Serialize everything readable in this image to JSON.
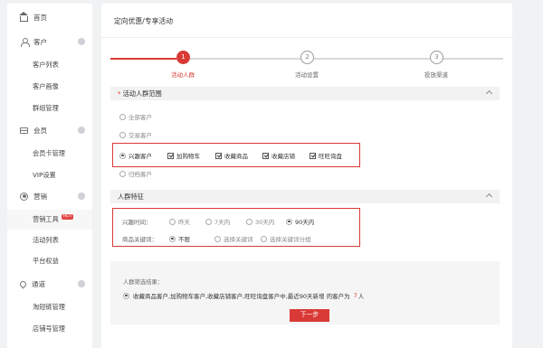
{
  "sidebar": {
    "home": "首页",
    "customer": {
      "label": "客户",
      "items": [
        "客户列表",
        "客户画像",
        "群组管理"
      ]
    },
    "member": {
      "label": "会员",
      "items": [
        "会员卡管理",
        "VIP设置"
      ]
    },
    "marketing": {
      "label": "营销",
      "items": [
        "营销工具",
        "活动列表",
        "平台权益"
      ],
      "hot_badge": "HOT"
    },
    "channel": {
      "label": "通道",
      "items": [
        "淘短链管理",
        "店铺号管理"
      ]
    }
  },
  "page_title": "定向优惠/专享活动",
  "steps": [
    {
      "num": "1",
      "label": "活动人群",
      "state": "active"
    },
    {
      "num": "2",
      "label": "活动设置",
      "state": "todo"
    },
    {
      "num": "3",
      "label": "投放渠道",
      "state": "todo"
    }
  ],
  "audience_scope": {
    "title": "活动人群范围",
    "required_mark": "*",
    "options": [
      "全部客户",
      "交易客户",
      "兴趣客户",
      "归档客户"
    ],
    "selected": "兴趣客户",
    "interest_checks": [
      "加购物车",
      "收藏商品",
      "收藏店铺",
      "旺旺询盘"
    ]
  },
  "features": {
    "title": "人群特征",
    "time_label": "兴趣时间：",
    "time_options": [
      "昨天",
      "7天内",
      "30天内",
      "90天内"
    ],
    "time_selected": "90天内",
    "keyword_label": "商品关键词：",
    "keyword_options": [
      "不限",
      "选择关键词",
      "选择关键词分组"
    ],
    "keyword_selected": "不限"
  },
  "result": {
    "title": "人群筛选结果：",
    "text": "收藏商品客户,加购物车客户,收藏店铺客户,旺旺询盘客户中,最近90天新增 的客户为",
    "count": "7",
    "unit": "人"
  },
  "next_button": "下一步",
  "colors": {
    "accent": "#d93a35",
    "step_done": "#d93a35",
    "step_todo": "#d9d9d9"
  }
}
